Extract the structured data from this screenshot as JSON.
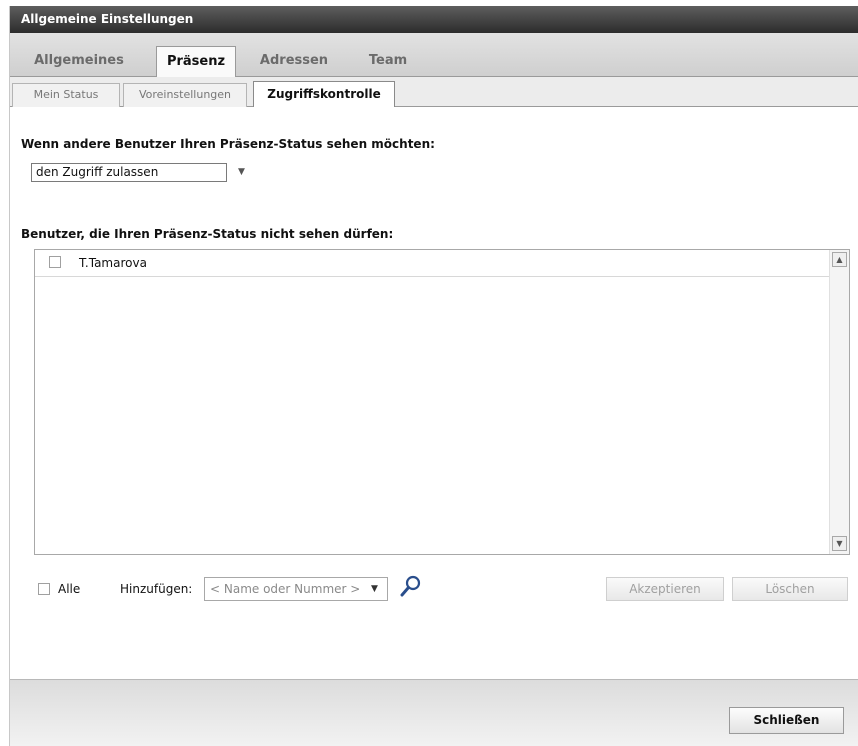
{
  "window": {
    "title": "Allgemeine Einstellungen"
  },
  "main_tabs": [
    {
      "label": "Allgemeines",
      "active": false
    },
    {
      "label": "Präsenz",
      "active": true
    },
    {
      "label": "Adressen",
      "active": false
    },
    {
      "label": "Team",
      "active": false
    }
  ],
  "sub_tabs": [
    {
      "label": "Mein Status",
      "active": false
    },
    {
      "label": "Voreinstellungen",
      "active": false
    },
    {
      "label": "Zugriffskontrolle",
      "active": true
    }
  ],
  "access": {
    "heading": "Wenn andere Benutzer Ihren Präsenz-Status sehen möchten:",
    "selected_value": "den Zugriff zulassen"
  },
  "blocked": {
    "heading": "Benutzer, die Ihren Präsenz-Status nicht sehen dürfen:",
    "users": [
      {
        "name": "T.Tamarova",
        "checked": false
      }
    ]
  },
  "bottom": {
    "all_label": "Alle",
    "all_checked": false,
    "add_label": "Hinzufügen:",
    "add_placeholder": "< Name oder Nummer >",
    "accept_label": "Akzeptieren",
    "delete_label": "Löschen"
  },
  "footer": {
    "close_label": "Schließen"
  },
  "icons": {
    "dropdown": "chevron-down-icon",
    "search": "magnifier-icon",
    "scroll_up": "arrow-up-icon",
    "scroll_down": "arrow-down-icon"
  }
}
